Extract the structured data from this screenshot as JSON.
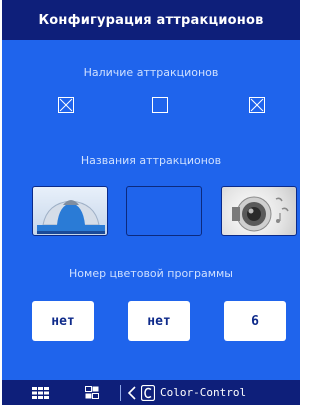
{
  "title": "Конфигурация аттракционов",
  "sections": {
    "presence_label": "Наличие аттракционов",
    "names_label": "Названия аттракционов",
    "color_program_label": "Номер цветовой программы"
  },
  "checkboxes": [
    {
      "checked": true
    },
    {
      "checked": false
    },
    {
      "checked": true
    }
  ],
  "attractions": [
    {
      "icon": "carousel-icon"
    },
    {
      "icon": "none"
    },
    {
      "icon": "speaker-icon"
    }
  ],
  "color_programs": [
    "нет",
    "нет",
    "6"
  ],
  "bottom_bar": {
    "grid_icon": "grid-3x3-icon",
    "grid2_icon": "grid-2x2-icon",
    "back_icon": "back-arrow-icon",
    "c_icon": "c-logo-icon",
    "app_name": "Color-Control"
  },
  "colors": {
    "background": "#1f64ec",
    "titlebar": "#0e1f7a",
    "accent_text": "#cfe0ff"
  }
}
